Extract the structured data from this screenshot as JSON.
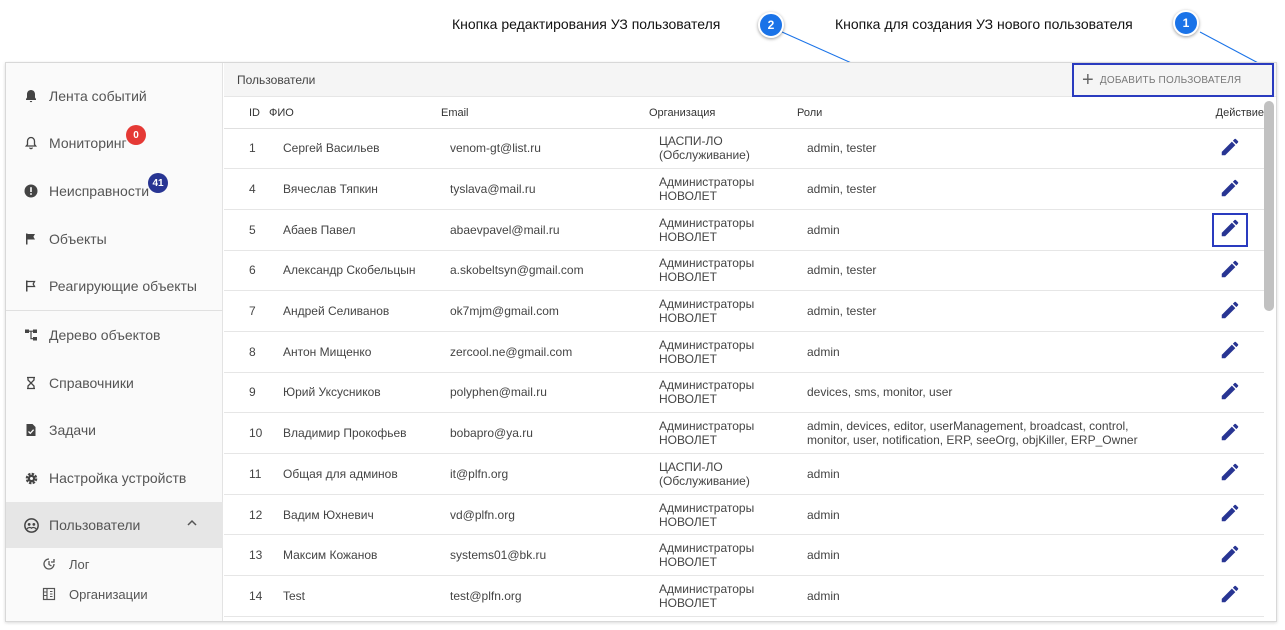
{
  "callouts": [
    {
      "number": "1",
      "text": "Кнопка для создания УЗ нового пользователя"
    },
    {
      "number": "2",
      "text": "Кнопка редактирования УЗ пользователя"
    }
  ],
  "sidebar": {
    "items": [
      {
        "label": "Лента событий",
        "icon": "bell-icon"
      },
      {
        "label": "Мониторинг",
        "icon": "bell-outline-icon",
        "badge": "0",
        "badge_color": "#e53935"
      },
      {
        "label": "Неисправности",
        "icon": "alert-circle-icon",
        "badge": "41",
        "badge_color": "#283593"
      },
      {
        "label": "Объекты",
        "icon": "flag-icon"
      },
      {
        "label": "Реагирующие объекты",
        "icon": "flag-outline-icon"
      },
      {
        "label": "Дерево объектов",
        "icon": "tree-icon"
      },
      {
        "label": "Справочники",
        "icon": "hourglass-icon"
      },
      {
        "label": "Задачи",
        "icon": "task-icon"
      },
      {
        "label": "Настройка устройств",
        "icon": "gear-icon"
      },
      {
        "label": "Пользователи",
        "icon": "users-icon",
        "active": true
      }
    ],
    "sub_items": [
      {
        "label": "Лог",
        "icon": "log-icon"
      },
      {
        "label": "Организации",
        "icon": "building-icon"
      }
    ]
  },
  "toolbar": {
    "title": "Пользователи",
    "add_label": "ДОБАВИТЬ ПОЛЬЗОВАТЕЛЯ"
  },
  "table": {
    "headers": {
      "id": "ID",
      "name": "ФИО",
      "email": "Email",
      "org": "Организация",
      "roles": "Роли",
      "action": "Действие"
    },
    "rows": [
      {
        "id": "1",
        "name": "Сергей Васильев",
        "email": "venom-gt@list.ru",
        "org1": "ЦАСПИ-ЛО",
        "org2": "(Обслуживание)",
        "roles1": "admin, tester",
        "roles2": ""
      },
      {
        "id": "4",
        "name": "Вячеслав Тяпкин",
        "email": "tyslava@mail.ru",
        "org1": "Администраторы",
        "org2": "НОВОЛЕТ",
        "roles1": "admin, tester",
        "roles2": ""
      },
      {
        "id": "5",
        "name": "Абаев Павел",
        "email": "abaevpavel@mail.ru",
        "org1": "Администраторы",
        "org2": "НОВОЛЕТ",
        "roles1": "admin",
        "roles2": ""
      },
      {
        "id": "6",
        "name": "Александр Скобельцын",
        "email": "a.skobeltsyn@gmail.com",
        "org1": "Администраторы",
        "org2": "НОВОЛЕТ",
        "roles1": "admin, tester",
        "roles2": ""
      },
      {
        "id": "7",
        "name": "Андрей Селиванов",
        "email": "ok7mjm@gmail.com",
        "org1": "Администраторы",
        "org2": "НОВОЛЕТ",
        "roles1": "admin, tester",
        "roles2": ""
      },
      {
        "id": "8",
        "name": "Антон Мищенко",
        "email": "zercool.ne@gmail.com",
        "org1": "Администраторы",
        "org2": "НОВОЛЕТ",
        "roles1": "admin",
        "roles2": ""
      },
      {
        "id": "9",
        "name": "Юрий Уксусников",
        "email": "polyphen@mail.ru",
        "org1": "Администраторы",
        "org2": "НОВОЛЕТ",
        "roles1": "devices, sms, monitor, user",
        "roles2": ""
      },
      {
        "id": "10",
        "name": "Владимир Прокофьев",
        "email": "bobapro@ya.ru",
        "org1": "Администраторы",
        "org2": "НОВОЛЕТ",
        "roles1": "admin, devices, editor, userManagement, broadcast, control,",
        "roles2": "monitor, user, notification, ERP, seeOrg, objKiller, ERP_Owner"
      },
      {
        "id": "11",
        "name": "Общая для админов",
        "email": "it@plfn.org",
        "org1": "ЦАСПИ-ЛО",
        "org2": "(Обслуживание)",
        "roles1": "admin",
        "roles2": ""
      },
      {
        "id": "12",
        "name": "Вадим Юхневич",
        "email": "vd@plfn.org",
        "org1": "Администраторы",
        "org2": "НОВОЛЕТ",
        "roles1": "admin",
        "roles2": ""
      },
      {
        "id": "13",
        "name": "Максим Кожанов",
        "email": "systems01@bk.ru",
        "org1": "Администраторы",
        "org2": "НОВОЛЕТ",
        "roles1": "admin",
        "roles2": ""
      },
      {
        "id": "14",
        "name": "Test",
        "email": "test@plfn.org",
        "org1": "Администраторы",
        "org2": "НОВОЛЕТ",
        "roles1": "admin",
        "roles2": ""
      }
    ]
  },
  "colors": {
    "accent": "#1a73e8",
    "highlight_border": "#2a3bbf",
    "edit_icon": "#283593"
  }
}
